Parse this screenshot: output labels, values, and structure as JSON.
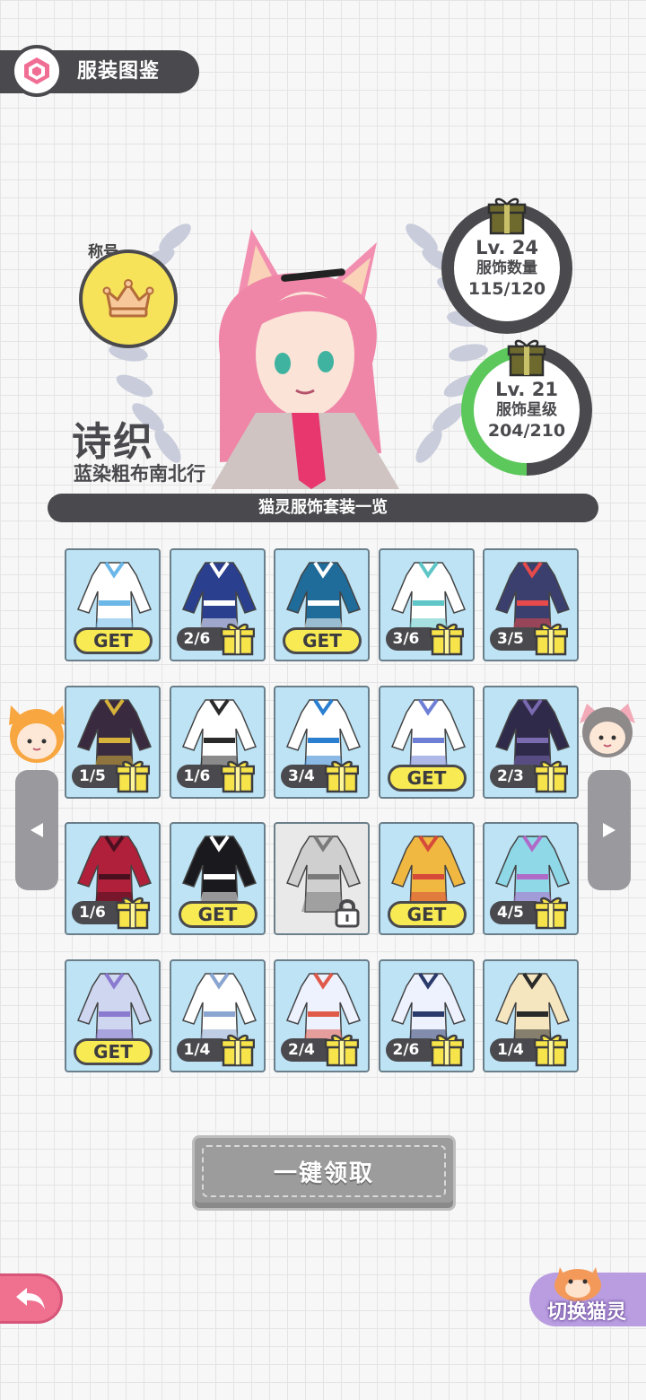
{
  "header": {
    "title": "服装图鉴",
    "icon": "wardrobe-icon"
  },
  "character": {
    "title_label": "称号",
    "title_icon": "crown-icon",
    "name": "诗织",
    "outfit_name": "蓝染粗布南北行"
  },
  "stats": {
    "count": {
      "level": "Lv. 24",
      "label": "服饰数量",
      "value": "115/120",
      "fraction": 0.958
    },
    "star": {
      "level": "Lv. 21",
      "label": "服饰星级",
      "value": "204/210",
      "fraction": 0.9714
    }
  },
  "collection_banner": "猫灵服饰套装一览",
  "outfits": [
    {
      "state": "get",
      "label": "GET",
      "variant": "white-hoodie"
    },
    {
      "state": "progress",
      "label": "2/6",
      "variant": "navy-dress"
    },
    {
      "state": "get",
      "label": "GET",
      "variant": "blue-qipao"
    },
    {
      "state": "progress",
      "label": "3/6",
      "variant": "white-gown"
    },
    {
      "state": "progress",
      "label": "3/5",
      "variant": "mech-armor"
    },
    {
      "state": "progress",
      "label": "1/5",
      "variant": "dark-lolita"
    },
    {
      "state": "progress",
      "label": "1/6",
      "variant": "maid-dress"
    },
    {
      "state": "progress",
      "label": "3/4",
      "variant": "blue-tailcoat"
    },
    {
      "state": "get",
      "label": "GET",
      "variant": "angel-dress"
    },
    {
      "state": "progress",
      "label": "2/3",
      "variant": "dark-armor"
    },
    {
      "state": "progress",
      "label": "1/6",
      "variant": "red-devil"
    },
    {
      "state": "get",
      "label": "GET",
      "variant": "black-jacket"
    },
    {
      "state": "locked",
      "label": "",
      "variant": "locked-outfit"
    },
    {
      "state": "get",
      "label": "GET",
      "variant": "school-uniform"
    },
    {
      "state": "progress",
      "label": "4/5",
      "variant": "idol-outfit"
    },
    {
      "state": "get",
      "label": "GET",
      "variant": "kimono"
    },
    {
      "state": "progress",
      "label": "1/4",
      "variant": "white-shirt"
    },
    {
      "state": "progress",
      "label": "2/4",
      "variant": "mecha-suit"
    },
    {
      "state": "progress",
      "label": "2/6",
      "variant": "sailor-uniform"
    },
    {
      "state": "progress",
      "label": "1/4",
      "variant": "cream-sweater"
    }
  ],
  "claim_all": "一键领取",
  "switch_cat": "切换猫灵",
  "colors": {
    "dark": "#4a4a4e",
    "cell_bg": "#bde3f5",
    "get_yellow": "#f7ea52",
    "gift_olive": "#6e6a2e",
    "ring_green": "#5cc85c",
    "back_pink": "#f07090",
    "switch_purple": "#b99de0"
  }
}
